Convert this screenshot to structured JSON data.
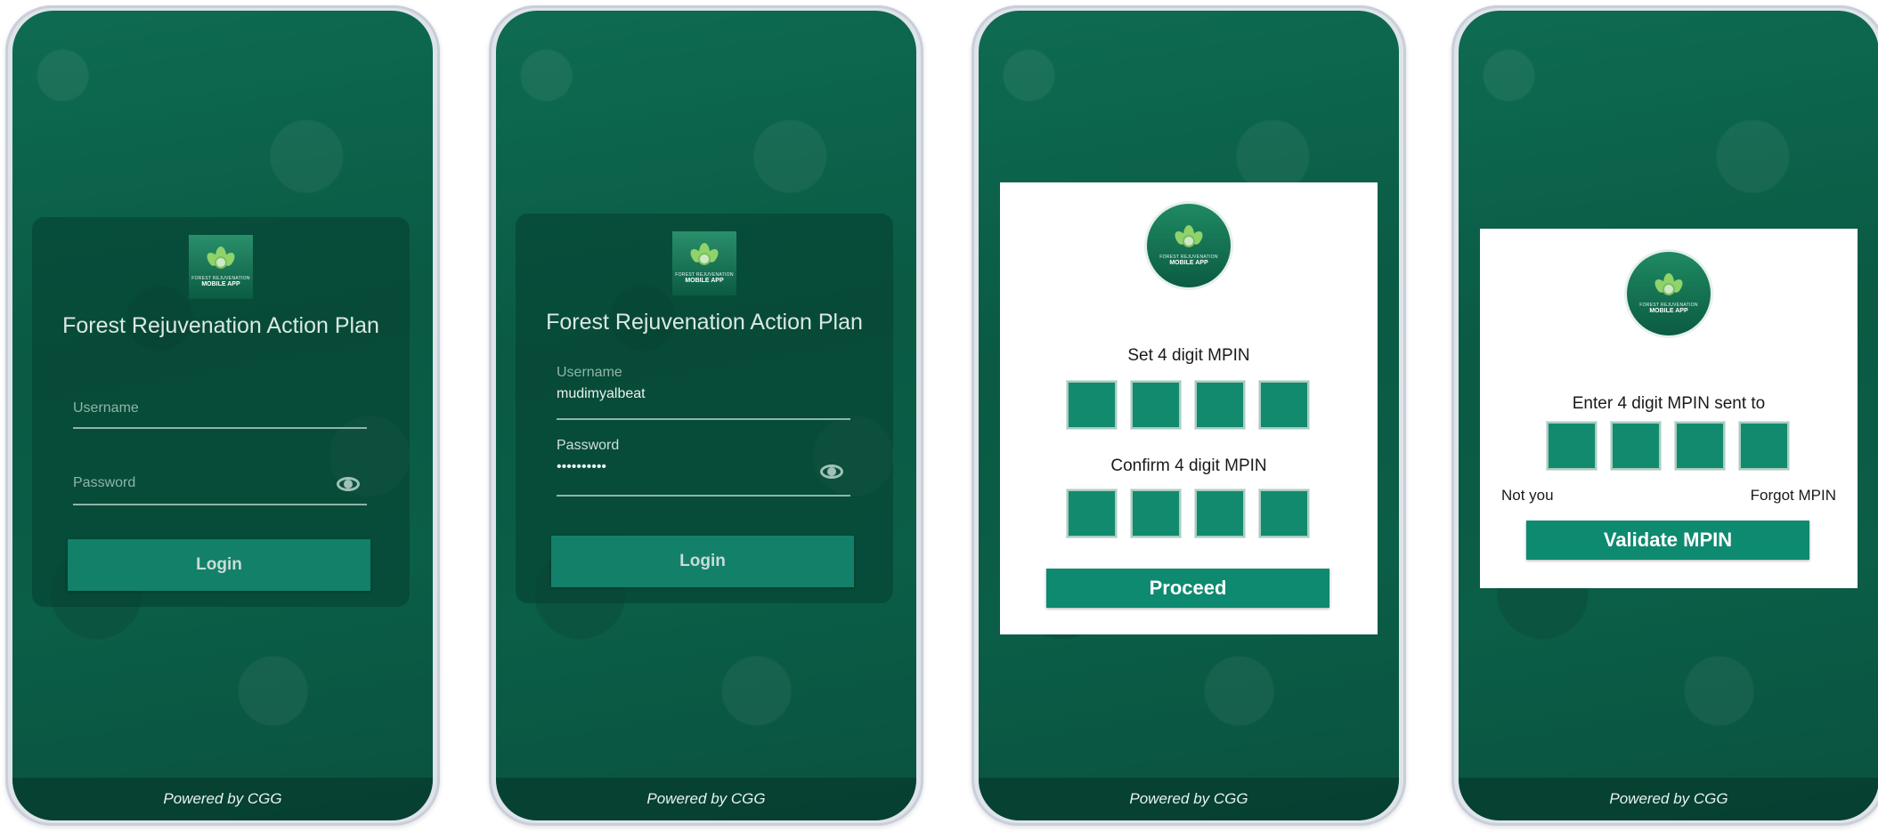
{
  "app": {
    "title": "Forest Rejuvenation Action Plan",
    "logo_line1": "FOREST REJUVENATION",
    "logo_line2": "MOBILE APP",
    "footer": "Powered by CGG"
  },
  "screen1": {
    "username_placeholder": "Username",
    "password_placeholder": "Password",
    "login_label": "Login"
  },
  "screen2": {
    "username_label": "Username",
    "username_value": "mudimyalbeat",
    "password_label": "Password",
    "password_value": "••••••••••",
    "login_label": "Login"
  },
  "screen3": {
    "set_label": "Set 4 digit MPIN",
    "confirm_label": "Confirm 4 digit MPIN",
    "proceed_label": "Proceed"
  },
  "screen4": {
    "enter_label": "Enter 4 digit MPIN sent to",
    "not_you_label": "Not you",
    "forgot_label": "Forgot MPIN",
    "validate_label": "Validate MPIN"
  },
  "colors": {
    "forest_green": "#0a5a44",
    "button_green": "#0e8a70",
    "pin_box": "#128a6e"
  },
  "icons": [
    "eye-icon",
    "app-logo-icon"
  ]
}
